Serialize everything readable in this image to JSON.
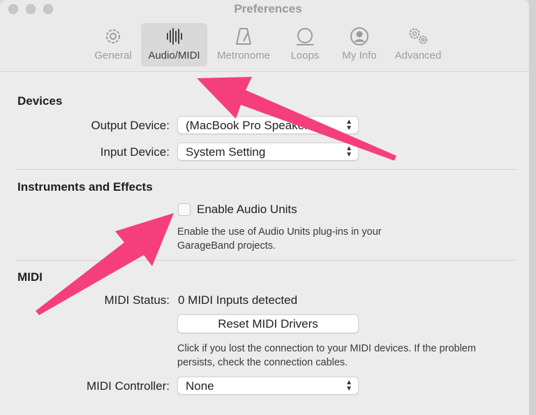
{
  "window": {
    "title": "Preferences"
  },
  "toolbar": {
    "tabs": [
      {
        "label": "General",
        "icon": "gear-icon"
      },
      {
        "label": "Audio/MIDI",
        "icon": "waveform-icon",
        "active": true
      },
      {
        "label": "Metronome",
        "icon": "metronome-icon"
      },
      {
        "label": "Loops",
        "icon": "loops-icon"
      },
      {
        "label": "My Info",
        "icon": "person-icon"
      },
      {
        "label": "Advanced",
        "icon": "gears-icon"
      }
    ]
  },
  "devices": {
    "heading": "Devices",
    "output_label": "Output Device:",
    "output_value": "(MacBook Pro Speakers)",
    "input_label": "Input Device:",
    "input_value": "System Setting"
  },
  "instruments": {
    "heading": "Instruments and Effects",
    "enable_label": "Enable Audio Units",
    "enable_checked": false,
    "description_line1": "Enable the use of Audio Units plug-ins in your",
    "description_line2": "GarageBand projects."
  },
  "midi": {
    "heading": "MIDI",
    "status_label": "MIDI Status:",
    "status_value": "0 MIDI Inputs detected",
    "reset_button": "Reset MIDI Drivers",
    "help_line1": "Click if you lost the connection to your MIDI devices. If the problem",
    "help_line2": "persists, check the connection cables.",
    "controller_label": "MIDI Controller:",
    "controller_value": "None"
  },
  "annotations": {
    "arrow_color": "#f43f7c"
  }
}
